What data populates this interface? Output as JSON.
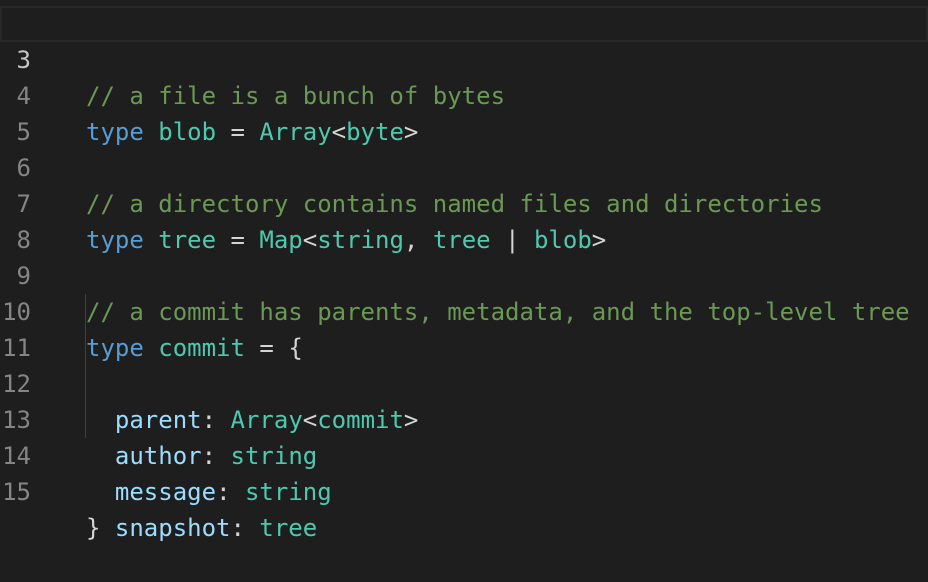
{
  "editor": {
    "lines": [
      {
        "number": "3",
        "comment": "// a file is a bunch of bytes"
      },
      {
        "number": "4",
        "kw": "type",
        "name": "blob",
        "eq": " = ",
        "generic": "Array",
        "open": "<",
        "arg": "byte",
        "close": ">"
      },
      {
        "number": "5"
      },
      {
        "number": "6",
        "comment": "// a directory contains named files and directories"
      },
      {
        "number": "7",
        "kw": "type",
        "name": "tree",
        "eq": " = ",
        "generic": "Map",
        "open": "<",
        "arg1": "string",
        "comma": ", ",
        "arg2": "tree",
        "pipe": " | ",
        "arg3": "blob",
        "close": ">"
      },
      {
        "number": "8"
      },
      {
        "number": "9",
        "comment": "// a commit has parents, metadata, and the top-level tree"
      },
      {
        "number": "10",
        "kw": "type",
        "name": "commit",
        "eq": " = ",
        "brace": "{"
      },
      {
        "number": "11",
        "prop": "parent",
        "colon": ": ",
        "generic": "Array",
        "open": "<",
        "arg": "commit",
        "close": ">"
      },
      {
        "number": "12",
        "prop": "author",
        "colon": ": ",
        "value": "string"
      },
      {
        "number": "13",
        "prop": "message",
        "colon": ": ",
        "value": "string"
      },
      {
        "number": "14",
        "prop": "snapshot",
        "colon": ": ",
        "value": "tree"
      },
      {
        "number": "15",
        "brace": "}"
      }
    ]
  }
}
